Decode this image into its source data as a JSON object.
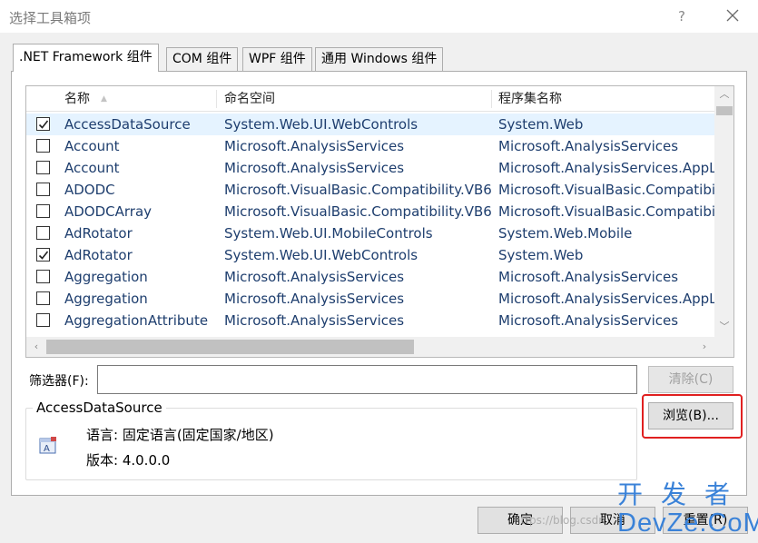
{
  "window": {
    "title": "选择工具箱项",
    "help_label": "?"
  },
  "tabs": [
    {
      "label": ".NET Framework 组件",
      "active": true
    },
    {
      "label": "COM 组件",
      "active": false
    },
    {
      "label": "WPF 组件",
      "active": false
    },
    {
      "label": "通用 Windows 组件",
      "active": false
    }
  ],
  "list": {
    "columns": [
      "名称",
      "命名空间",
      "程序集名称"
    ],
    "rows": [
      {
        "checked": true,
        "selected": true,
        "name": "AccessDataSource",
        "namespace": "System.Web.UI.WebControls",
        "assembly": "System.Web"
      },
      {
        "checked": false,
        "selected": false,
        "name": "Account",
        "namespace": "Microsoft.AnalysisServices",
        "assembly": "Microsoft.AnalysisServices"
      },
      {
        "checked": false,
        "selected": false,
        "name": "Account",
        "namespace": "Microsoft.AnalysisServices",
        "assembly": "Microsoft.AnalysisServices.AppL"
      },
      {
        "checked": false,
        "selected": false,
        "name": "ADODC",
        "namespace": "Microsoft.VisualBasic.Compatibility.VB6",
        "assembly": "Microsoft.VisualBasic.Compatibil"
      },
      {
        "checked": false,
        "selected": false,
        "name": "ADODCArray",
        "namespace": "Microsoft.VisualBasic.Compatibility.VB6",
        "assembly": "Microsoft.VisualBasic.Compatibil"
      },
      {
        "checked": false,
        "selected": false,
        "name": "AdRotator",
        "namespace": "System.Web.UI.MobileControls",
        "assembly": "System.Web.Mobile"
      },
      {
        "checked": true,
        "selected": false,
        "name": "AdRotator",
        "namespace": "System.Web.UI.WebControls",
        "assembly": "System.Web"
      },
      {
        "checked": false,
        "selected": false,
        "name": "Aggregation",
        "namespace": "Microsoft.AnalysisServices",
        "assembly": "Microsoft.AnalysisServices"
      },
      {
        "checked": false,
        "selected": false,
        "name": "Aggregation",
        "namespace": "Microsoft.AnalysisServices",
        "assembly": "Microsoft.AnalysisServices.AppL"
      },
      {
        "checked": false,
        "selected": false,
        "name": "AggregationAttribute",
        "namespace": "Microsoft.AnalysisServices",
        "assembly": "Microsoft.AnalysisServices"
      }
    ]
  },
  "filter": {
    "label": "筛选器(F):",
    "value": "",
    "clear_label": "清除(C)"
  },
  "details": {
    "group_title": "AccessDataSource",
    "language_line": "语言: 固定语言(固定国家/地区)",
    "version_line": "版本: 4.0.0.0",
    "browse_label": "浏览(B)..."
  },
  "footer": {
    "ok_label": "确定",
    "cancel_label": "取消",
    "reset_label": "重置(R)"
  },
  "watermark": {
    "logo_top": "开发者",
    "logo_bottom": "DevZe.CoM",
    "url": "https://blog.csdn"
  },
  "colors": {
    "cell_text": "#1e3e6e",
    "selected_row": "#e5f3ff",
    "highlight": "#e02020",
    "watermark": "#3a82d8"
  }
}
